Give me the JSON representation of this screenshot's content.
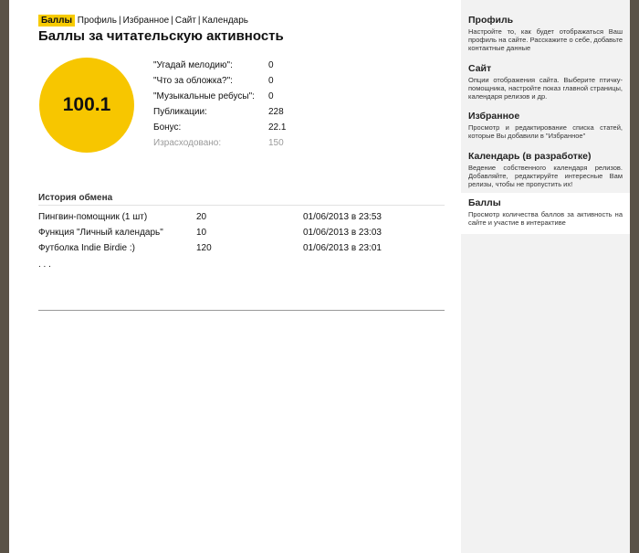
{
  "breadcrumbs": {
    "active": "Баллы",
    "links": [
      "Профиль",
      "Избранное",
      "Сайт",
      "Календарь"
    ],
    "separator": "|"
  },
  "page_title": "Баллы за читательскую активность",
  "score": "100.1",
  "colors": {
    "accent": "#f7c600",
    "sidebar_bg": "#f2f2f2",
    "frame": "#5a5247"
  },
  "stats": [
    {
      "label": "\"Угадай мелодию\":",
      "value": "0"
    },
    {
      "label": "\"Что за обложка?\":",
      "value": "0"
    },
    {
      "label": "\"Музыкальные ребусы\":",
      "value": "0"
    },
    {
      "label": "Публикации:",
      "value": "228"
    },
    {
      "label": "Бонус:",
      "value": "22.1"
    },
    {
      "label": "Израсходовано:",
      "value": "150"
    }
  ],
  "history": {
    "title": "История обмена",
    "rows": [
      {
        "item": "Пингвин-помощник (1 шт)",
        "cost": "20",
        "date": "01/06/2013 в 23:53"
      },
      {
        "item": "Функция \"Личный календарь\"",
        "cost": "10",
        "date": "01/06/2013 в 23:03"
      },
      {
        "item": "Футболка Indie Birdie :)",
        "cost": "120",
        "date": "01/06/2013 в 23:01"
      }
    ],
    "more": ". . ."
  },
  "sidebar": {
    "items": [
      {
        "title": "Профиль",
        "desc": "Настройте то, как будет отображаться Ваш профиль на сайте. Расскажите о себе, добавьте контактные данные"
      },
      {
        "title": "Сайт",
        "desc": "Опции отображения сайта. Выберите птичку-помощника, настройте показ главной страницы, календаря релизов и др."
      },
      {
        "title": "Избранное",
        "desc": "Просмотр и редактирование списка статей, которые Вы добавили в \"Избранное\""
      },
      {
        "title": "Календарь (в разработке)",
        "desc": "Ведение собственного календаря релизов. Добавляйте, редактируйте интересные Вам релизы, чтобы не пропустить их!"
      },
      {
        "title": "Баллы",
        "desc": "Просмотр количества баллов за активность на сайте и участие в интерактиве"
      }
    ]
  }
}
